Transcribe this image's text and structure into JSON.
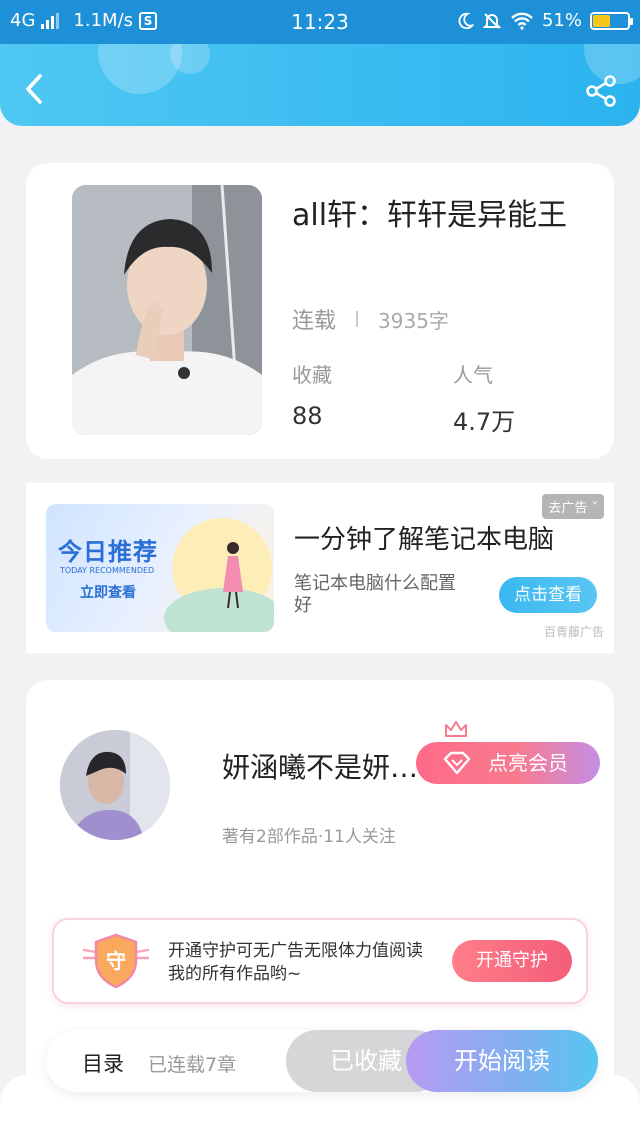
{
  "status_bar": {
    "network": "4G",
    "speed": "1.1M/s",
    "s_badge": "S",
    "time": "11:23",
    "battery": "51%",
    "battery_level": 0.51,
    "icons": [
      "signal-icon",
      "s-badge-icon",
      "moon-icon",
      "mute-bell-icon",
      "wifi-icon",
      "battery-icon"
    ]
  },
  "header": {
    "accent_color": "#2bb3ef",
    "back_icon": "chevron-left-icon",
    "share_icon": "share-icon"
  },
  "book": {
    "title": "all轩：轩轩是异能王",
    "status": "连载",
    "word_count": "3935字",
    "favorites_label": "收藏",
    "favorites_value": "88",
    "popularity_label": "人气",
    "popularity_value": "4.7万"
  },
  "ad": {
    "tag": "去广告",
    "image_title": "今日推荐",
    "image_subtitle": "TODAY RECOMMENDED",
    "image_cta": "立即查看",
    "title": "一分钟了解笔记本电脑",
    "description": "笔记本电脑什么配置好",
    "button": "点击查看",
    "source": "百青藤广告"
  },
  "author": {
    "name": "妍涵曦不是妍…",
    "vip_button": "点亮会员",
    "meta": "著有2部作品·11人关注"
  },
  "guard": {
    "shield_char": "守",
    "text": "开通守护可无广告无限体力值阅读我的所有作品哟~",
    "button": "开通守护"
  },
  "bottom_bar": {
    "toc": "目录",
    "chapters": "已连载7章",
    "collected": "已收藏",
    "read": "开始阅读"
  }
}
